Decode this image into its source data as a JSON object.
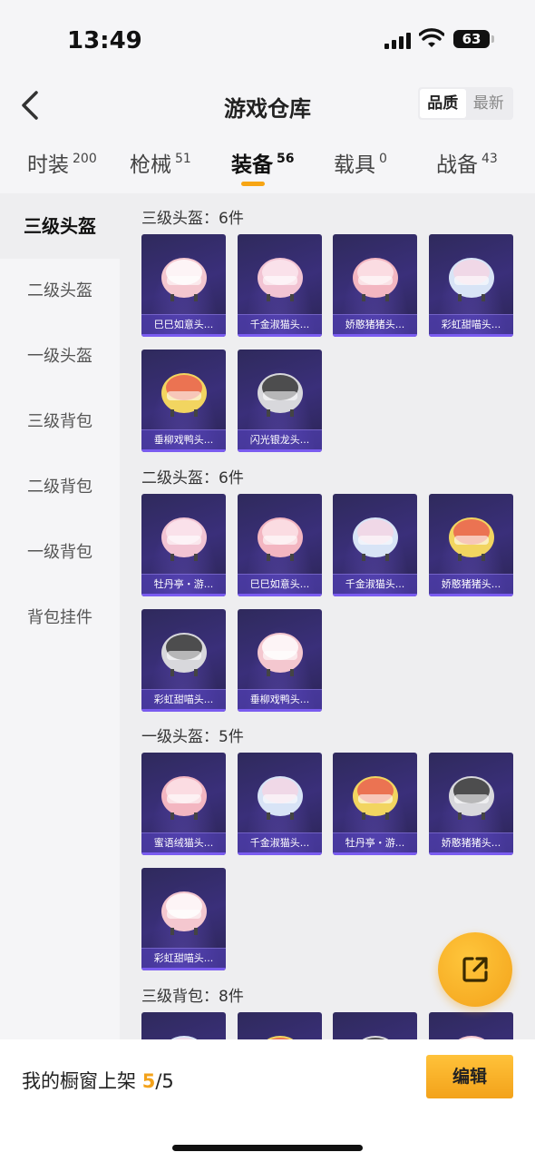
{
  "status": {
    "time": "13:49",
    "battery": "63"
  },
  "header": {
    "title": "游戏仓库",
    "sort_options": [
      "品质",
      "最新"
    ],
    "sort_active": "品质"
  },
  "tabs": [
    {
      "label": "时装",
      "count": "200"
    },
    {
      "label": "枪械",
      "count": "51"
    },
    {
      "label": "装备",
      "count": "56",
      "active": true
    },
    {
      "label": "载具",
      "count": "0"
    },
    {
      "label": "战备",
      "count": "43"
    }
  ],
  "sidebar": {
    "items": [
      "三级头盔",
      "二级头盔",
      "一级头盔",
      "三级背包",
      "二级背包",
      "一级背包",
      "背包挂件"
    ],
    "active": "三级头盔"
  },
  "sections": [
    {
      "title": "三级头盔：6件",
      "items": [
        "巳巳如意头...",
        "千金淑猫头...",
        "娇憨猪猪头...",
        "彩虹甜喵头...",
        "垂柳戏鸭头...",
        "闪光银龙头..."
      ]
    },
    {
      "title": "二级头盔：6件",
      "items": [
        "牡丹亭・游...",
        "巳巳如意头...",
        "千金淑猫头...",
        "娇憨猪猪头...",
        "彩虹甜喵头...",
        "垂柳戏鸭头..."
      ]
    },
    {
      "title": "一级头盔：5件",
      "items": [
        "蜜语绒猫头...",
        "千金淑猫头...",
        "牡丹亭・游...",
        "娇憨猪猪头...",
        "彩虹甜喵头..."
      ]
    },
    {
      "title": "三级背包：8件",
      "items": [
        "",
        "",
        "",
        ""
      ]
    }
  ],
  "bottom": {
    "shelf_label": "我的橱窗上架",
    "shelf_count": "5",
    "shelf_total": "/5",
    "edit_label": "编辑"
  },
  "colors": {
    "accent": "#f3a21a",
    "card_bg": "#3a2f7a"
  }
}
